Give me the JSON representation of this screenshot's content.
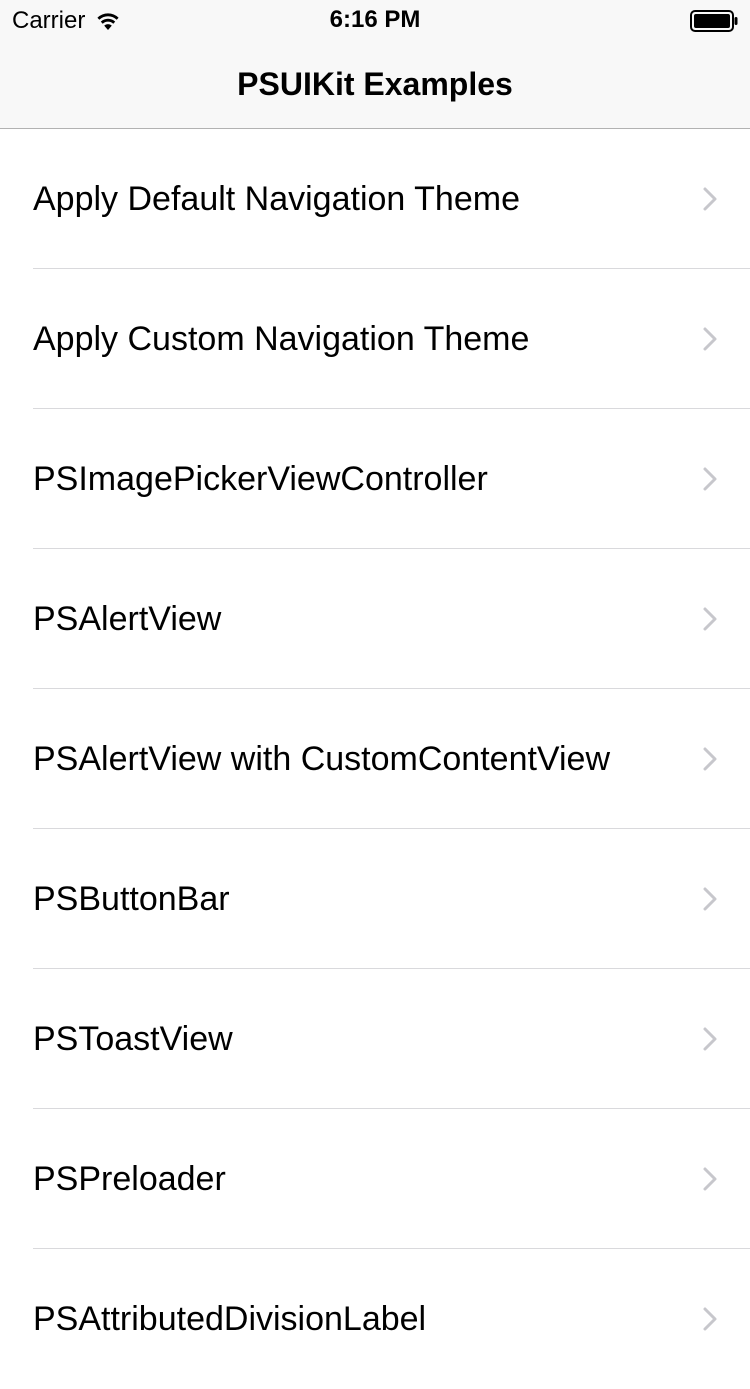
{
  "status_bar": {
    "carrier": "Carrier",
    "time": "6:16 PM"
  },
  "nav": {
    "title": "PSUIKit Examples"
  },
  "rows": [
    {
      "label": "Apply Default Navigation Theme"
    },
    {
      "label": "Apply Custom Navigation Theme"
    },
    {
      "label": "PSImagePickerViewController"
    },
    {
      "label": "PSAlertView"
    },
    {
      "label": "PSAlertView with CustomContentView"
    },
    {
      "label": "PSButtonBar"
    },
    {
      "label": "PSToastView"
    },
    {
      "label": "PSPreloader"
    },
    {
      "label": "PSAttributedDivisionLabel"
    }
  ],
  "icons": {
    "wifi": "wifi-icon",
    "battery": "battery-icon",
    "disclosure": "chevron-right-icon"
  },
  "colors": {
    "chevron": "#c7c7cc",
    "separator": "#d9d9dc",
    "bar_background": "#f8f8f8"
  }
}
